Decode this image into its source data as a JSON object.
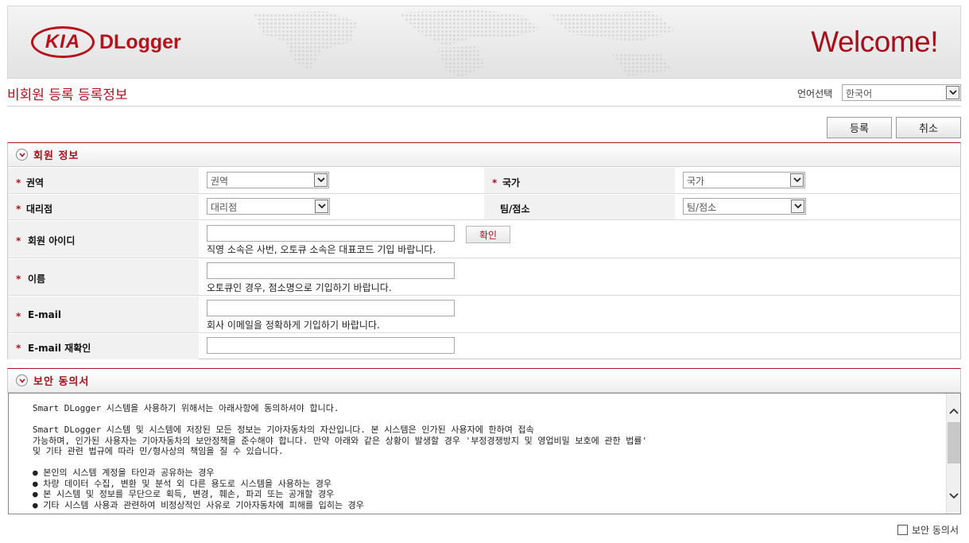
{
  "header": {
    "brand": "KIA",
    "app_name": "DLogger",
    "welcome": "Welcome!"
  },
  "page_title": "비회원 등록 등록정보",
  "language": {
    "label": "언어선택",
    "selected": "한국어"
  },
  "actions": {
    "register": "등록",
    "cancel": "취소"
  },
  "member_section": {
    "title": "회원 정보",
    "region": {
      "label": "권역",
      "selected": "권역"
    },
    "country": {
      "label": "국가",
      "selected": "국가"
    },
    "dealer": {
      "label": "대리점",
      "selected": "대리점"
    },
    "team": {
      "label": "팀/점소",
      "selected": "팀/점소"
    },
    "member_id": {
      "label": "회원 아이디",
      "value": "",
      "check_button": "확인",
      "hint": "직영 소속은 사번, 오토큐 소속은 대표코드 기입 바랍니다."
    },
    "name": {
      "label": "이름",
      "value": "",
      "hint": "오토큐인 경우, 점소명으로 기입하기 바랍니다."
    },
    "email": {
      "label": "E-mail",
      "value": "",
      "hint": "회사 이메일을 정확하게 기입하기 바랍니다."
    },
    "email_confirm": {
      "label": "E-mail 재확인",
      "value": ""
    },
    "required_mark": "*"
  },
  "security_section": {
    "title": "보안 동의서",
    "text": "Smart DLogger 시스템을 사용하기 위해서는 아래사항에 동의하셔야 합니다.\n\nSmart DLogger 시스템 및 시스템에 저장된 모든 정보는 기아자동차의 자산입니다. 본 시스템은 인가된 사용자에 한하여 접속\n가능하며, 인가된 사용자는 기아자동차의 보안정책을 준수해야 합니다. 만약 아래와 같은 상황이 발생할 경우 '부정경쟁방지 및 영업비밀 보호에 관한 법률'\n및 기타 관련 법규에 따라 민/형사상의 책임을 질 수 있습니다.\n\n● 본인의 시스템 계정을 타인과 공유하는 경우\n● 차량 데이터 수집, 변환 및 분석 외 다른 용도로 시스템을 사용하는 경우\n● 본 시스템 및 정보를 무단으로 획득, 변경, 훼손, 파괴 또는 공개할 경우\n● 기타 시스템 사용과 관련하여 비정상적인 사유로 기아자동차에 피해를 입히는 경우",
    "agree_label": "보안 동의서",
    "agreed": false
  },
  "colors": {
    "brand_red": "#b5121b",
    "title_red": "#b01020"
  }
}
